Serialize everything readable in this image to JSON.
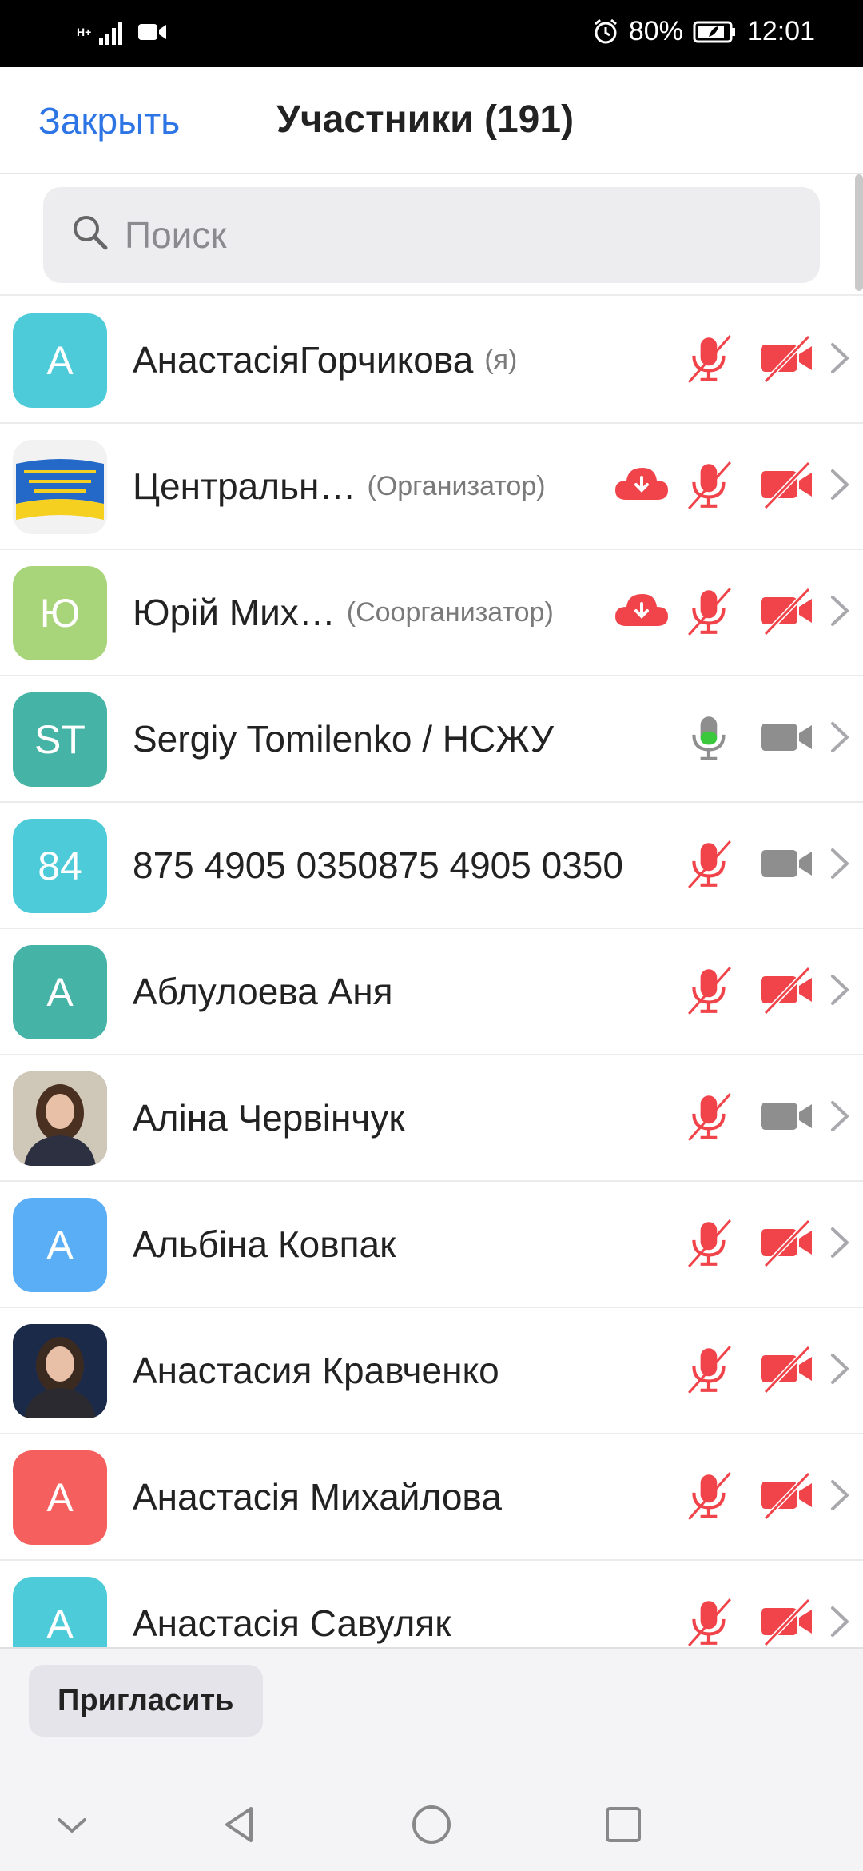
{
  "status_bar": {
    "network": "H+",
    "alarm_icon": "alarm-icon",
    "battery": "80%",
    "time": "12:01"
  },
  "header": {
    "close_label": "Закрыть",
    "title": "Участники (191)"
  },
  "search": {
    "placeholder": "Поиск"
  },
  "participants": [
    {
      "initials": "А",
      "name": "АнастасіяГорчикова",
      "role": "(я)",
      "avatar_color": "#4ecbd9",
      "cloud": false,
      "mic": "muted",
      "video": "off"
    },
    {
      "initials": "",
      "name": "Центральн…",
      "role": "(Организатор)",
      "avatar_color": "#f0f0f0",
      "avatar_image": "union-logo",
      "cloud": true,
      "mic": "muted",
      "video": "off"
    },
    {
      "initials": "Ю",
      "name": "Юрій Мих…",
      "role": "(Соорганизатор)",
      "avatar_color": "#a8d57a",
      "cloud": true,
      "mic": "muted",
      "video": "off"
    },
    {
      "initials": "ST",
      "name": "Sergiy Tomilenko / НСЖУ",
      "role": "",
      "avatar_color": "#45b3a5",
      "cloud": false,
      "mic": "active",
      "video": "available"
    },
    {
      "initials": "84",
      "name": "875 4905 0350875 4905 0350",
      "role": "",
      "avatar_color": "#4ecbd9",
      "cloud": false,
      "mic": "muted",
      "video": "available"
    },
    {
      "initials": "А",
      "name": "Аблулоева Аня",
      "role": "",
      "avatar_color": "#45b3a5",
      "cloud": false,
      "mic": "muted",
      "video": "off"
    },
    {
      "initials": "",
      "name": "Аліна Червінчук",
      "role": "",
      "avatar_color": "#8a8a7a",
      "avatar_image": "photo",
      "cloud": false,
      "mic": "muted",
      "video": "available"
    },
    {
      "initials": "А",
      "name": "Альбіна Ковпак",
      "role": "",
      "avatar_color": "#5aaef5",
      "cloud": false,
      "mic": "muted",
      "video": "off"
    },
    {
      "initials": "",
      "name": "Анастасия Кравченко",
      "role": "",
      "avatar_color": "#2a3a5a",
      "avatar_image": "photo",
      "cloud": false,
      "mic": "muted",
      "video": "off"
    },
    {
      "initials": "А",
      "name": "Анастасія Михайлова",
      "role": "",
      "avatar_color": "#f5605f",
      "cloud": false,
      "mic": "muted",
      "video": "off"
    },
    {
      "initials": "А",
      "name": "Анастасія Савуляк",
      "role": "",
      "avatar_color": "#4ecbd9",
      "cloud": false,
      "mic": "muted",
      "video": "off"
    }
  ],
  "footer": {
    "invite_label": "Пригласить"
  },
  "colors": {
    "accent": "#2d74e4",
    "muted_red": "#f0444a",
    "active_green": "#3cc83c",
    "neutral_gray": "#8e8e8e"
  }
}
